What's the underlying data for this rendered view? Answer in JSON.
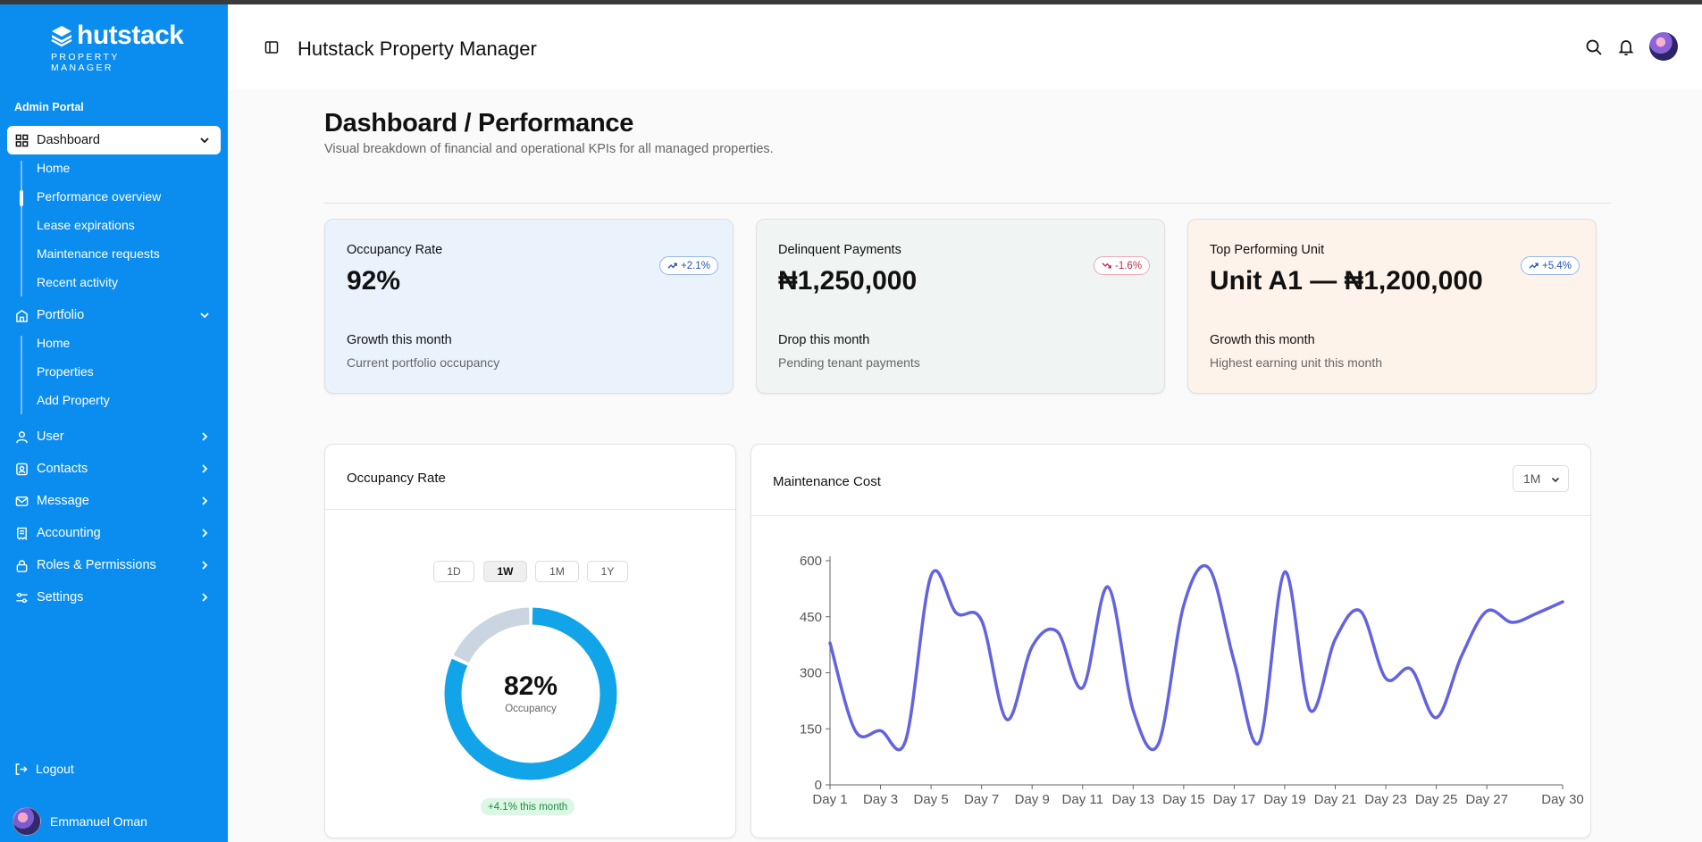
{
  "app": {
    "title": "Hutstack Property Manager"
  },
  "sidebar": {
    "logo_main": "hutstack",
    "logo_sub": "PROPERTY MANAGER",
    "section_label": "Admin Portal",
    "dashboard": {
      "label": "Dashboard",
      "sub": [
        "Home",
        "Performance overview",
        "Lease expirations",
        "Maintenance requests",
        "Recent activity"
      ]
    },
    "portfolio": {
      "label": "Portfolio",
      "sub": [
        "Home",
        "Properties",
        "Add Property"
      ]
    },
    "items": [
      "User",
      "Contacts",
      "Message",
      "Accounting",
      "Roles & Permissions",
      "Settings"
    ],
    "logout": "Logout",
    "user_name": "Emmanuel Oman"
  },
  "page": {
    "title": "Dashboard / Performance",
    "subtitle": "Visual breakdown of financial and operational KPIs for all managed properties."
  },
  "kpis": [
    {
      "label": "Occupancy Rate",
      "value": "92%",
      "badge": "+2.1%",
      "trend": "up",
      "foot1": "Growth this month",
      "foot2": "Current portfolio occupancy",
      "bg": "#eaf3fc"
    },
    {
      "label": "Delinquent Payments",
      "value": "₦1,250,000",
      "badge": "-1.6%",
      "trend": "down",
      "foot1": "Drop this month",
      "foot2": "Pending tenant payments",
      "bg": "#f0f4f2"
    },
    {
      "label": "Top Performing Unit",
      "value": "Unit A1 — ₦1,200,000",
      "badge": "+5.4%",
      "trend": "up",
      "foot1": "Growth this month",
      "foot2": "Highest earning unit this month",
      "bg": "#fdf3ea"
    }
  ],
  "occupancy_card": {
    "title": "Occupancy Rate",
    "ranges": [
      "1D",
      "1W",
      "1M",
      "1Y"
    ],
    "active_range": "1W",
    "percent_label": "82%",
    "percent_value": 82,
    "caption": "Occupancy",
    "change": "+4.1% this month",
    "colors": {
      "filled": "#12a4e8",
      "empty": "#cbd5e1"
    }
  },
  "maintenance_card": {
    "title": "Maintenance Cost",
    "period": "1M"
  },
  "chart_data": {
    "type": "line",
    "title": "Maintenance Cost",
    "x": [
      "Day 1",
      "Day 2",
      "Day 3",
      "Day 4",
      "Day 5",
      "Day 6",
      "Day 7",
      "Day 8",
      "Day 9",
      "Day 10",
      "Day 11",
      "Day 12",
      "Day 13",
      "Day 14",
      "Day 15",
      "Day 16",
      "Day 17",
      "Day 18",
      "Day 19",
      "Day 20",
      "Day 21",
      "Day 22",
      "Day 23",
      "Day 24",
      "Day 25",
      "Day 26",
      "Day 27",
      "Day 28",
      "Day 29",
      "Day 30"
    ],
    "x_tick_labels": [
      "Day 1",
      "Day 3",
      "Day 5",
      "Day 7",
      "Day 9",
      "Day 11",
      "Day 13",
      "Day 15",
      "Day 17",
      "Day 19",
      "Day 21",
      "Day 23",
      "Day 25",
      "Day 27",
      "Day 30"
    ],
    "series": [
      {
        "values": [
          380,
          145,
          145,
          120,
          560,
          460,
          440,
          175,
          370,
          410,
          260,
          530,
          200,
          110,
          480,
          580,
          330,
          115,
          570,
          200,
          390,
          465,
          285,
          310,
          180,
          345,
          465,
          435,
          460,
          490
        ],
        "color": "#6363e0"
      }
    ],
    "ylim": [
      0,
      600
    ],
    "yticks": [
      0,
      150,
      300,
      450,
      600
    ],
    "grid": false
  }
}
